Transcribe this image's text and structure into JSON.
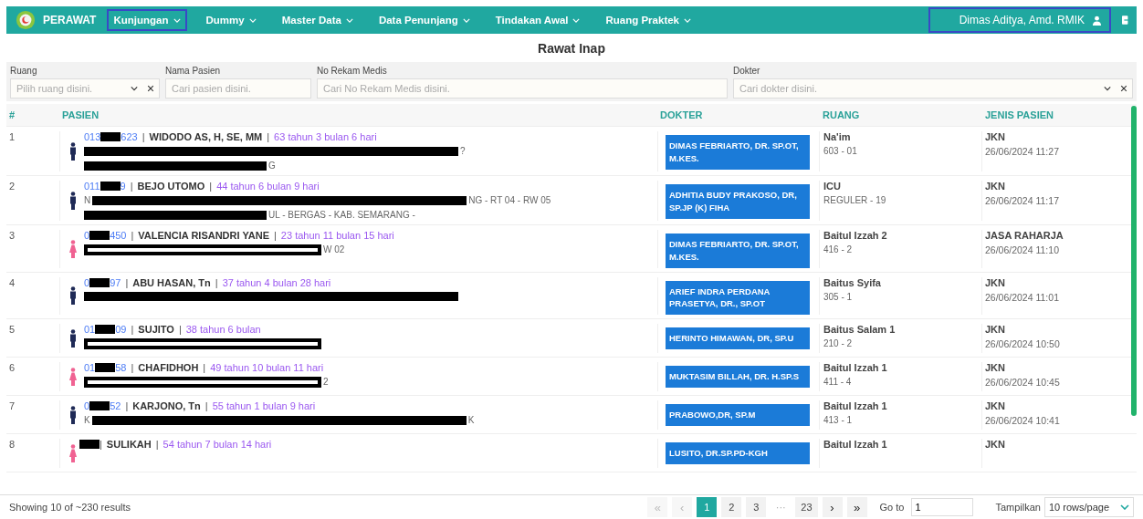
{
  "navbar": {
    "brand": "PERAWAT",
    "menu": [
      {
        "label": "Kunjungan",
        "selected": true
      },
      {
        "label": "Dummy",
        "selected": false
      },
      {
        "label": "Master Data",
        "selected": false
      },
      {
        "label": "Data Penunjang",
        "selected": false
      },
      {
        "label": "Tindakan Awal",
        "selected": false
      },
      {
        "label": "Ruang Praktek",
        "selected": false
      }
    ],
    "user": {
      "name": "Dimas Aditya, Amd. RMIK",
      "selected": true
    }
  },
  "page_title": "Rawat Inap",
  "filters": [
    {
      "label": "Ruang",
      "placeholder": "Pilih ruang disini.",
      "kind": "select"
    },
    {
      "label": "Nama Pasien",
      "placeholder": "Cari pasien disini.",
      "kind": "text"
    },
    {
      "label": "No Rekam Medis",
      "placeholder": "Cari No Rekam Medis disini.",
      "kind": "text"
    },
    {
      "label": "Dokter",
      "placeholder": "Cari dokter disini.",
      "kind": "select"
    }
  ],
  "table": {
    "columns": [
      "#",
      "PASIEN",
      "DOKTER",
      "RUANG",
      "JENIS PASIEN"
    ],
    "rows": [
      {
        "no": "1",
        "female": false,
        "rm_head": "013",
        "rm_tail": "623",
        "separators": [
          "|",
          "|"
        ],
        "name": "WIDODO AS, H, SE, MM",
        "age": "63 tahun 3 bulan 6 hari",
        "outlined_redaction": false,
        "address_lines": [
          {
            "redacted": true,
            "tail": "?"
          },
          {
            "redacted": true,
            "tail": "G"
          }
        ],
        "doctor": "DIMAS FEBRIARTO, DR. SP.OT, M.KES.",
        "room": "Na'im",
        "bed": "603 - 01",
        "type": "JKN",
        "date": "26/06/2024 11:27"
      },
      {
        "no": "2",
        "female": false,
        "rm_head": "011",
        "rm_tail": "9",
        "separators": [
          "|",
          "|"
        ],
        "name": "BEJO UTOMO",
        "age": "44 tahun 6 bulan 9 hari",
        "outlined_redaction": false,
        "address_lines": [
          {
            "head": "N",
            "redacted": true,
            "tail": "NG - RT 04 - RW 05"
          },
          {
            "redacted": true,
            "tail": "UL - BERGAS - KAB. SEMARANG -"
          }
        ],
        "doctor": "ADHITIA BUDY PRAKOSO, DR, SP.JP (K) FIHA",
        "room": "ICU",
        "bed": "REGULER - 19",
        "type": "JKN",
        "date": "26/06/2024 11:17"
      },
      {
        "no": "3",
        "female": true,
        "rm_head": "0",
        "rm_tail": "450",
        "separators": [
          "|",
          "|"
        ],
        "name": "VALENCIA RISANDRI YANE",
        "age": "23 tahun 11 bulan 15 hari",
        "outlined_redaction": true,
        "address_lines": [
          {
            "redacted": true,
            "tail": "W 02"
          }
        ],
        "doctor": "DIMAS FEBRIARTO, DR. SP.OT, M.KES.",
        "room": "Baitul Izzah 2",
        "bed": "416 - 2",
        "type": "JASA RAHARJA",
        "date": "26/06/2024 11:10"
      },
      {
        "no": "4",
        "female": false,
        "rm_head": "0",
        "rm_tail": "97",
        "separators": [
          "|",
          "|"
        ],
        "name": "ABU HASAN, Tn",
        "age": "37 tahun 4 bulan 28 hari",
        "outlined_redaction": false,
        "address_lines": [
          {
            "redacted": true
          }
        ],
        "doctor": "ARIEF INDRA PERDANA PRASETYA, DR., SP.OT",
        "room": "Baitus Syifa",
        "bed": "305 - 1",
        "type": "JKN",
        "date": "26/06/2024 11:01"
      },
      {
        "no": "5",
        "female": false,
        "rm_head": "01",
        "rm_tail": "09",
        "separators": [
          "|",
          "|"
        ],
        "name": "SUJITO",
        "age": "38 tahun 6 bulan",
        "outlined_redaction": true,
        "address_lines": [
          {
            "redacted": true
          }
        ],
        "doctor": "HERINTO HIMAWAN, DR, SP.U",
        "room": "Baitus Salam 1",
        "bed": "210 - 2",
        "type": "JKN",
        "date": "26/06/2024 10:50"
      },
      {
        "no": "6",
        "female": true,
        "rm_head": "01",
        "rm_tail": "58",
        "separators": [
          "|",
          "|"
        ],
        "name": "CHAFIDHOH",
        "age": "49 tahun 10 bulan 11 hari",
        "outlined_redaction": true,
        "address_lines": [
          {
            "redacted": true,
            "tail": "2"
          }
        ],
        "doctor": "MUKTASIM BILLAH, DR. H.SP.S",
        "room": "Baitul Izzah 1",
        "bed": "411 - 4",
        "type": "JKN",
        "date": "26/06/2024 10:45"
      },
      {
        "no": "7",
        "female": false,
        "rm_head": "0",
        "rm_tail": "52",
        "separators": [
          "|",
          "|"
        ],
        "name": "KARJONO, Tn",
        "age": "55 tahun 1 bulan 9 hari",
        "outlined_redaction": false,
        "address_lines": [
          {
            "head": "K",
            "redacted": true,
            "tail": "K"
          }
        ],
        "doctor": "PRABOWO,DR, SP.M",
        "room": "Baitul Izzah 1",
        "bed": "413 - 1",
        "type": "JKN",
        "date": "26/06/2024 10:41"
      },
      {
        "no": "8",
        "female": true,
        "separators": [
          "|",
          "|"
        ],
        "name": "SULIKAH",
        "age": "54 tahun 7 bulan 14 hari",
        "doctor": "LUSITO, DR.SP.PD-KGH",
        "room": "Baitul Izzah 1",
        "type": "JKN"
      }
    ]
  },
  "footer": {
    "summary": "Showing 10 of ~230 results",
    "pages": [
      {
        "label": "«",
        "kind": "nav",
        "disabled": true
      },
      {
        "label": "‹",
        "kind": "nav",
        "disabled": true
      },
      {
        "label": "1",
        "kind": "page",
        "selected": true
      },
      {
        "label": "2",
        "kind": "page",
        "selected": false
      },
      {
        "label": "3",
        "kind": "page",
        "selected": false
      },
      {
        "label": "···",
        "kind": "gap"
      },
      {
        "label": "23",
        "kind": "page",
        "selected": false
      },
      {
        "label": "›",
        "kind": "nav",
        "disabled": false
      },
      {
        "label": "»",
        "kind": "nav",
        "disabled": false
      }
    ],
    "goto_label": "Go to",
    "goto_value": "1",
    "rows_label": "Tampilkan",
    "rows_value": "10 rows/page"
  }
}
